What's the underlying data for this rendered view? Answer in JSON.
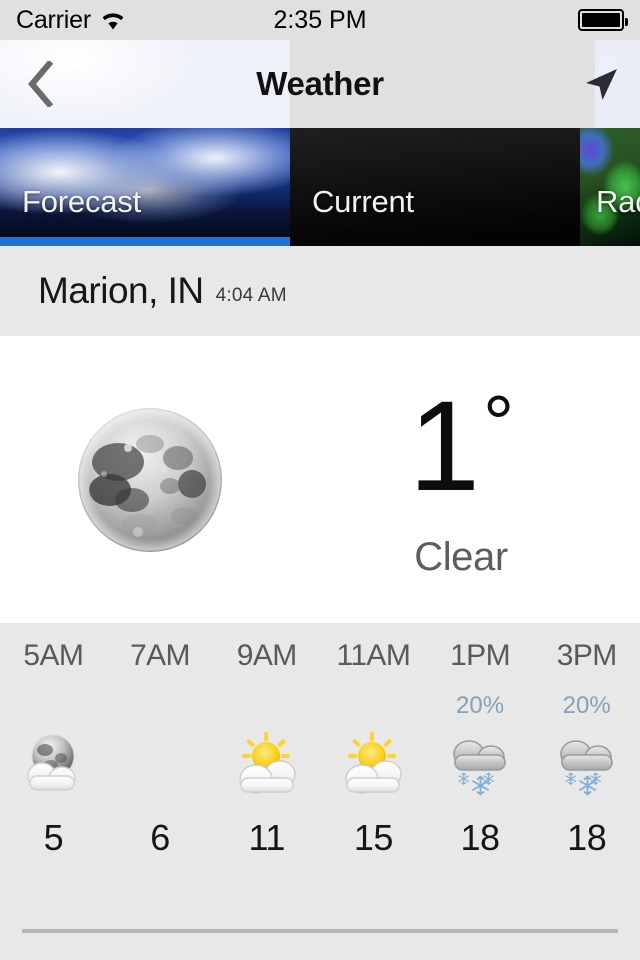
{
  "status_bar": {
    "carrier": "Carrier",
    "wifi_icon": "wifi-icon",
    "time": "2:35 PM",
    "battery_icon": "battery-full-icon"
  },
  "nav_bar": {
    "back_icon": "chevron-left-icon",
    "title": "Weather",
    "locate_icon": "navigation-arrow-icon"
  },
  "tabs": [
    {
      "label": "Forecast",
      "active": true,
      "underline_color": "#1a73d8"
    },
    {
      "label": "Current",
      "active": false,
      "underline_color": "transparent"
    },
    {
      "label": "Radar",
      "active": false,
      "underline_color": "transparent"
    }
  ],
  "location": {
    "name": "Marion, IN",
    "local_time": "4:04 AM"
  },
  "current": {
    "icon": "full-moon-icon",
    "temperature": "1",
    "degree_symbol": "°",
    "condition": "Clear"
  },
  "hourly": [
    {
      "hour": "5AM",
      "pop": "",
      "icon": "moon-behind-cloud-icon",
      "temp": "5"
    },
    {
      "hour": "7AM",
      "pop": "",
      "icon": "none",
      "temp": "6"
    },
    {
      "hour": "9AM",
      "pop": "",
      "icon": "sun-behind-cloud-icon",
      "temp": "11"
    },
    {
      "hour": "11AM",
      "pop": "",
      "icon": "sun-behind-cloud-icon",
      "temp": "15"
    },
    {
      "hour": "1PM",
      "pop": "20%",
      "icon": "snow-cloud-icon",
      "temp": "18"
    },
    {
      "hour": "3PM",
      "pop": "20%",
      "icon": "snow-cloud-icon",
      "temp": "18"
    }
  ],
  "colors": {
    "accent_blue": "#1a73d8",
    "page_bg": "#e8e8e8",
    "card_bg": "#ffffff",
    "pop_text": "#86a0b8",
    "snowflake": "#7fb0d6"
  }
}
